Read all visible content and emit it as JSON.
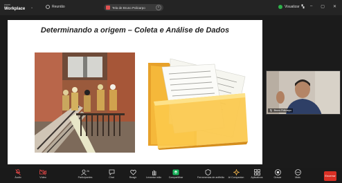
{
  "app": {
    "brand_small": "zoom",
    "brand_main": "Workplace",
    "meeting_label": "Reunião"
  },
  "tab": {
    "title": "Tela de Bruno Policarpo"
  },
  "header": {
    "view_label": "Visualizar"
  },
  "slide": {
    "title": "Determinando a origem – Coleta e Análise de Dados"
  },
  "video": {
    "participant_name": "Bruno Policarpo"
  },
  "toolbar": {
    "items": [
      {
        "label": "Áudio",
        "icon": "mic-muted-icon"
      },
      {
        "label": "Vídeo",
        "icon": "video-muted-icon"
      },
      {
        "label": "Participantes",
        "icon": "participants-icon",
        "count": "26"
      },
      {
        "label": "Chat",
        "icon": "chat-icon"
      },
      {
        "label": "Reagir",
        "icon": "react-icon"
      },
      {
        "label": "Levantar mão",
        "icon": "raise-hand-icon"
      },
      {
        "label": "Compartilhar",
        "icon": "share-icon"
      },
      {
        "label": "Ferramentas de anfitrião",
        "icon": "host-tools-icon"
      },
      {
        "label": "AI Companion",
        "icon": "ai-companion-icon"
      },
      {
        "label": "Aplicativos",
        "icon": "apps-icon"
      },
      {
        "label": "Gravar",
        "icon": "record-icon"
      },
      {
        "label": "Mais",
        "icon": "more-icon"
      }
    ],
    "leave_label": "Encerrar"
  },
  "colors": {
    "accent_red": "#d93025",
    "share_green": "#1bb55c",
    "folder_orange": "#f2a81d"
  }
}
